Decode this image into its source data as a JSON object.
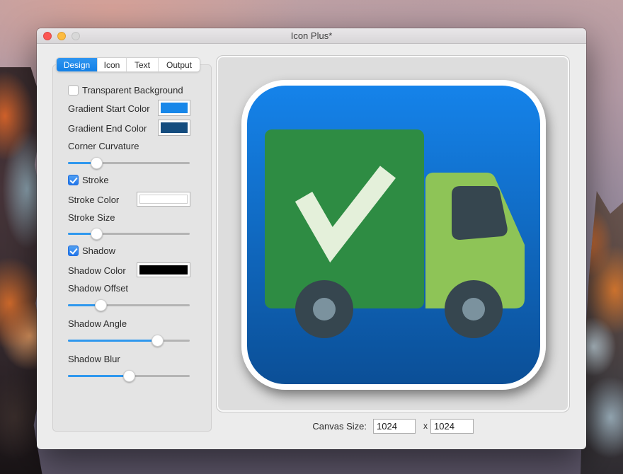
{
  "window": {
    "title": "Icon Plus*"
  },
  "titlebar_buttons": {
    "close": "close",
    "minimize": "minimize",
    "zoom": "zoom"
  },
  "tabs": [
    {
      "label": "Design",
      "active": true
    },
    {
      "label": "Icon",
      "active": false
    },
    {
      "label": "Text",
      "active": false
    },
    {
      "label": "Output",
      "active": false
    }
  ],
  "design_panel": {
    "transparent_background": {
      "label": "Transparent Background",
      "checked": false
    },
    "gradient_start": {
      "label": "Gradient Start Color",
      "color": "#1787e9"
    },
    "gradient_end": {
      "label": "Gradient End Color",
      "color": "#144c7e"
    },
    "corner_curvature": {
      "label": "Corner Curvature",
      "value_pct": 23
    },
    "stroke": {
      "label": "Stroke",
      "checked": true
    },
    "stroke_color": {
      "label": "Stroke Color",
      "color": "#ffffff"
    },
    "stroke_size": {
      "label": "Stroke Size",
      "value_pct": 23
    },
    "shadow": {
      "label": "Shadow",
      "checked": true
    },
    "shadow_color": {
      "label": "Shadow Color",
      "color": "#000000"
    },
    "shadow_offset": {
      "label": "Shadow Offset",
      "value_pct": 27
    },
    "shadow_angle": {
      "label": "Shadow Angle",
      "value_pct": 73
    },
    "shadow_blur": {
      "label": "Shadow Blur",
      "value_pct": 50
    }
  },
  "preview_icon": {
    "gradient_top": "#1583ea",
    "gradient_bottom": "#0b4f97",
    "stroke_color": "#ffffff",
    "truck": {
      "cargo_green": "#2e8c43",
      "cab_green": "#8ec457",
      "window_slate": "#36464f",
      "wheel_slate": "#36464f",
      "hub_gray": "#7b929e",
      "check_cream": "#e4f0da"
    }
  },
  "canvas_size": {
    "label": "Canvas Size:",
    "width": "1024",
    "separator": "x",
    "height": "1024"
  }
}
